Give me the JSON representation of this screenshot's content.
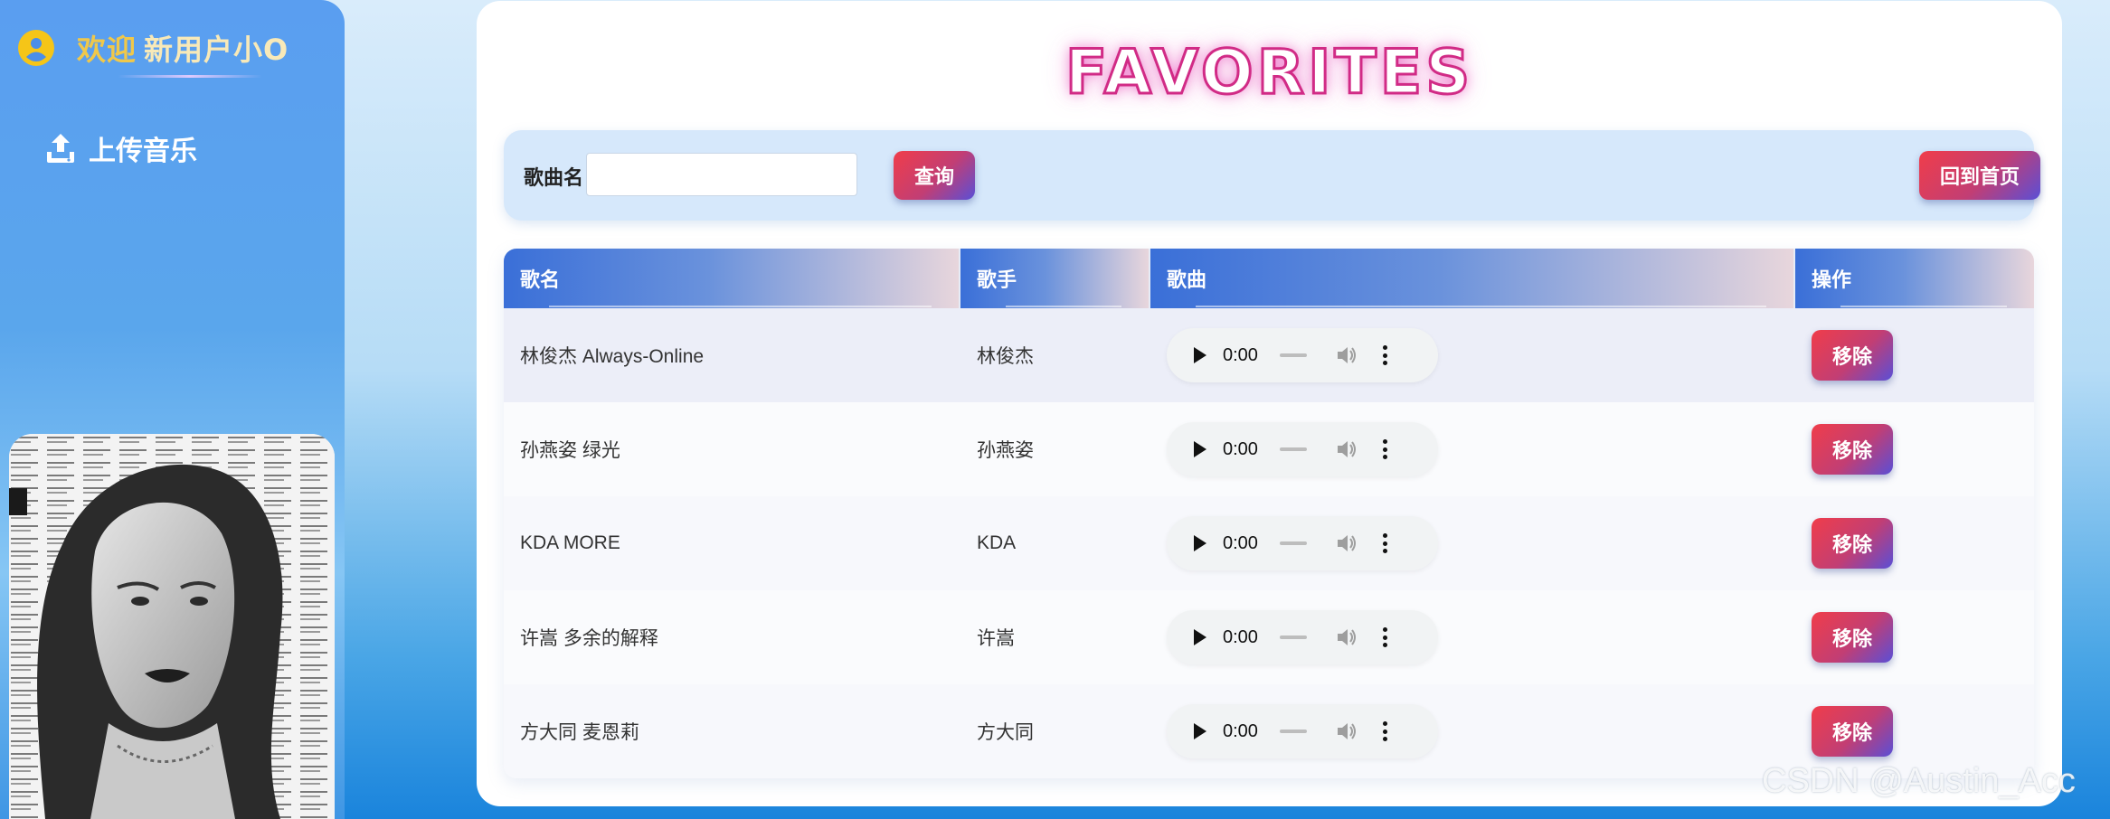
{
  "sidebar": {
    "welcome": "欢迎",
    "username": "新用户小O",
    "upload_label": "上传音乐"
  },
  "main": {
    "title": "FAVORITES",
    "search": {
      "label": "歌曲名",
      "value": "",
      "placeholder": "",
      "query_label": "查询",
      "home_label": "回到首页"
    },
    "table": {
      "headers": [
        "歌名",
        "歌手",
        "歌曲",
        "操作"
      ],
      "rows": [
        {
          "song": "林俊杰 Always-Online",
          "artist": "林俊杰",
          "time": "0:00",
          "action": "移除"
        },
        {
          "song": "孙燕姿 绿光",
          "artist": "孙燕姿",
          "time": "0:00",
          "action": "移除"
        },
        {
          "song": "KDA MORE",
          "artist": "KDA",
          "time": "0:00",
          "action": "移除"
        },
        {
          "song": "许嵩 多余的解释",
          "artist": "许嵩",
          "time": "0:00",
          "action": "移除"
        },
        {
          "song": "方大同 麦恩莉",
          "artist": "方大同",
          "time": "0:00",
          "action": "移除"
        }
      ]
    }
  },
  "watermark": "CSDN @Austin_Acc",
  "icons": {
    "user": "user-circle-icon",
    "upload": "upload-icon",
    "play": "play-icon",
    "volume": "volume-icon",
    "more": "kebab-menu-icon"
  },
  "colors": {
    "accent_gradient_start": "#f03d4a",
    "accent_gradient_end": "#5a4fd6",
    "title_stroke": "#d12b86",
    "welcome_text": "#f0c84a"
  }
}
